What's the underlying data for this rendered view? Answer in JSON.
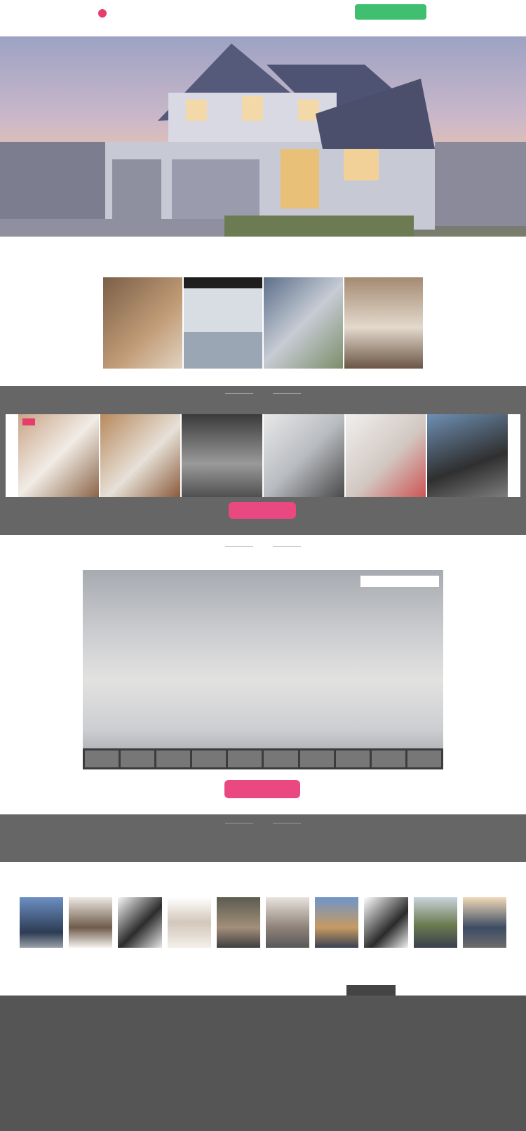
{
  "header": {
    "logo_text": "",
    "tagline": "",
    "phone": "",
    "cta_label": "",
    "nav": [
      "",
      "",
      "",
      "",
      "",
      "",
      "",
      "",
      ""
    ]
  },
  "hero": {
    "alt": ""
  },
  "features": [
    {
      "title": "",
      "sub": ""
    },
    {
      "title": "",
      "sub": ""
    },
    {
      "title": "",
      "sub": ""
    },
    {
      "title": "",
      "sub": ""
    }
  ],
  "colors": {
    "accent_green": "#3fbf6f",
    "accent_pink": "#ea4880",
    "band_gray": "#666666",
    "footer_gray": "#555555"
  },
  "gallery4": [
    "",
    "",
    "",
    ""
  ],
  "works": {
    "title": "",
    "button_label": "",
    "items": [
      {
        "badge": ""
      },
      {
        "badge": ""
      },
      {
        "badge": ""
      },
      {
        "badge": ""
      },
      {
        "badge": ""
      },
      {
        "badge": ""
      }
    ]
  },
  "tour": {
    "title": "",
    "label": "",
    "button_label": ""
  },
  "band2": {
    "title": "",
    "sub": ""
  },
  "thumbs": {
    "title": "",
    "count": 10
  },
  "footer": {
    "columns": [
      {
        "head": "",
        "items": [
          "",
          "",
          "",
          "",
          "",
          ""
        ]
      },
      {
        "head": "",
        "items": [
          "",
          "",
          "",
          "",
          "",
          ""
        ]
      },
      {
        "head": "",
        "items": [
          "",
          "",
          "",
          "",
          ""
        ]
      },
      {
        "head": "",
        "items": [
          "",
          "",
          "",
          "",
          "",
          ""
        ]
      },
      {
        "head": "",
        "items": [
          "",
          "",
          "",
          ""
        ]
      }
    ],
    "copyright": ""
  }
}
